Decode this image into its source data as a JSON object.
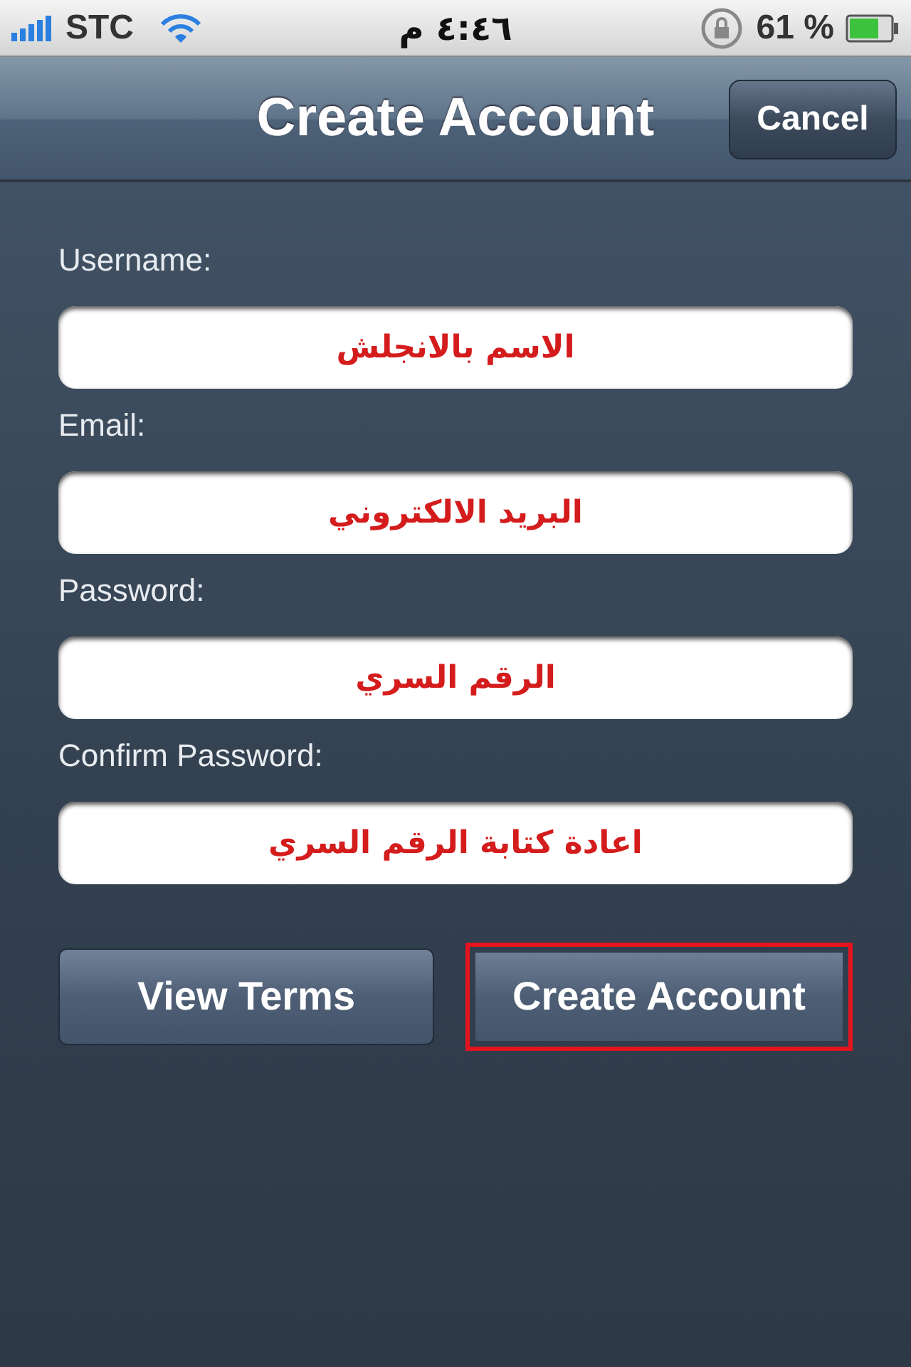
{
  "status_bar": {
    "carrier": "STC",
    "time": "٤:٤٦ م",
    "battery": "61 %"
  },
  "nav_bar": {
    "title": "Create Account",
    "button": "Cancel"
  },
  "fields": [
    {
      "label": "Username:",
      "value": "الاسم بالانجلش"
    },
    {
      "label": "Email:",
      "value": "البريد الالكتروني"
    },
    {
      "label": "Password:",
      "value": "الرقم السري"
    },
    {
      "label": "Confirm Password:",
      "value": "اعادة كتابة الرقم السري"
    }
  ],
  "terms_button": {
    "label": "View Terms",
    "highlighted": false
  },
  "submit_button": {
    "label": "Create Account",
    "highlighted": true
  }
}
